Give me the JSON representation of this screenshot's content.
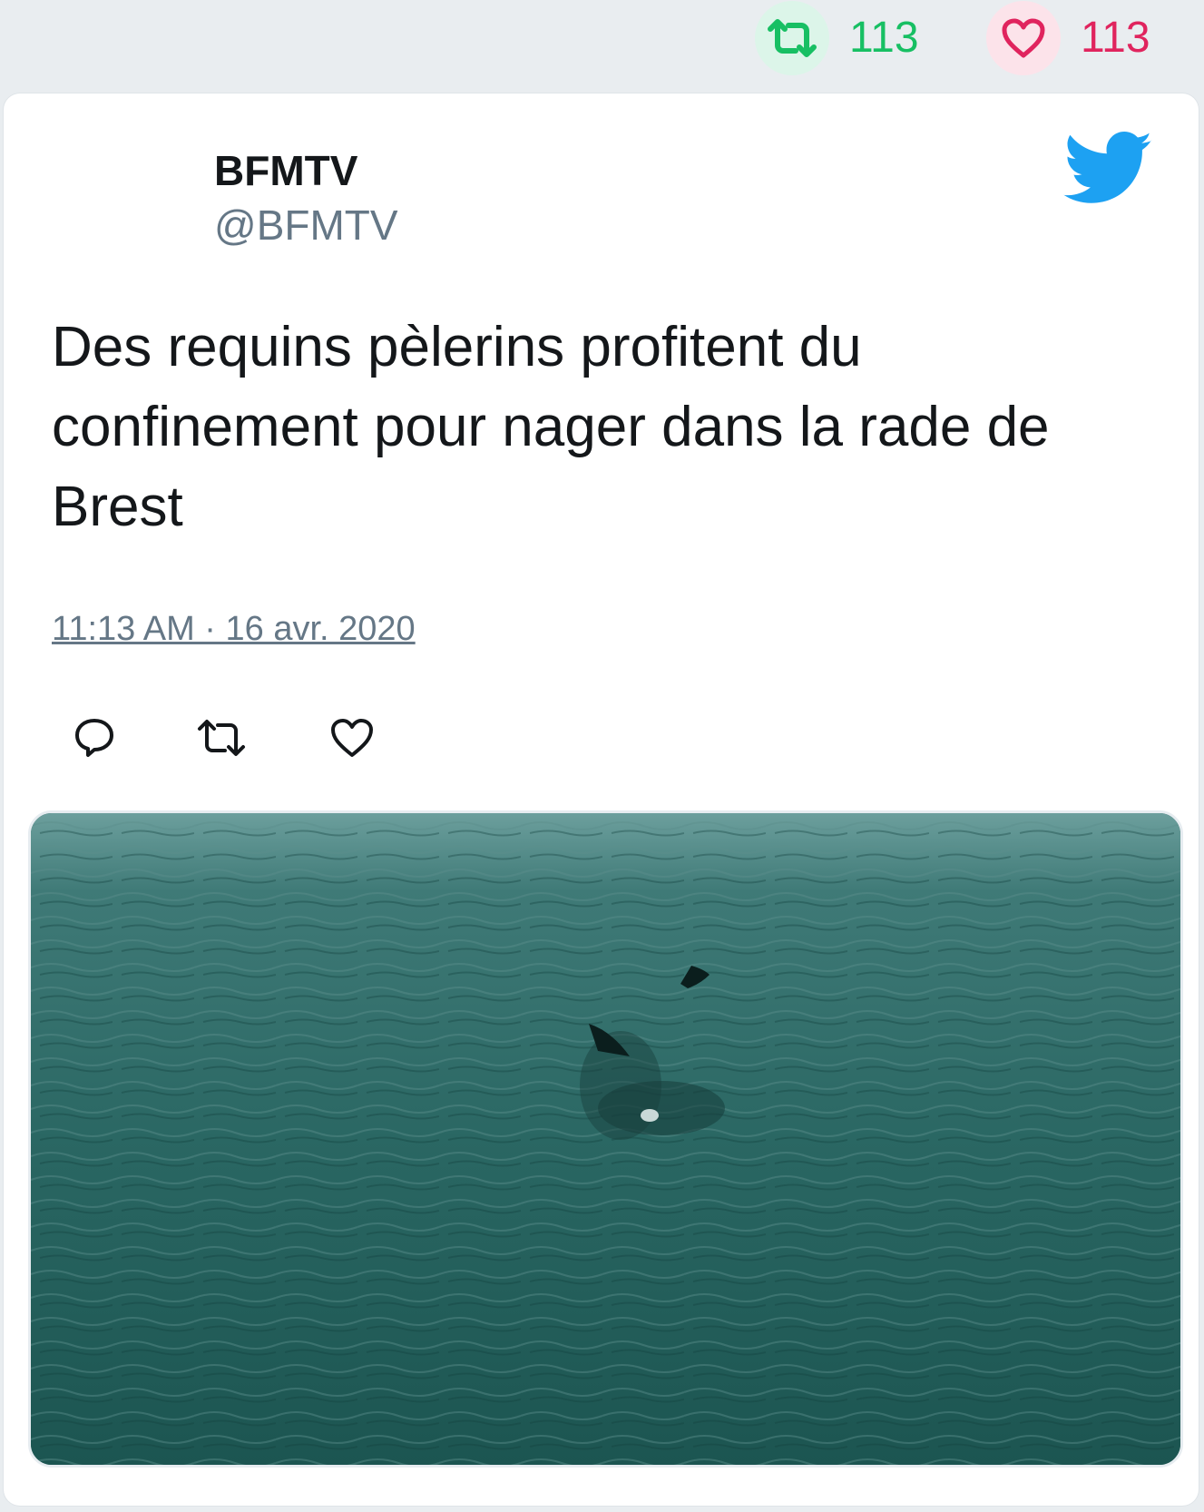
{
  "stats": {
    "retweet_count": "113",
    "like_count": "113"
  },
  "tweet": {
    "author_name": "BFMTV",
    "author_handle": "@BFMTV",
    "text": "Des requins pèlerins profitent du confinement pour nager dans la rade de Brest",
    "timestamp": "11:13 AM · 16 avr. 2020"
  },
  "icons": {
    "retweet_stat": "retweet-icon",
    "like_stat": "heart-icon",
    "logo": "twitter-bird-icon",
    "reply": "reply-icon",
    "retweet": "retweet-icon",
    "like": "heart-icon"
  },
  "colors": {
    "retweet_green": "#17bf63",
    "like_red": "#e0245e",
    "twitter_blue": "#1da1f2",
    "handle_gray": "#657786",
    "text_dark": "#14171a",
    "page_bg": "#e9edf0"
  },
  "media": {
    "description": "photo"
  }
}
